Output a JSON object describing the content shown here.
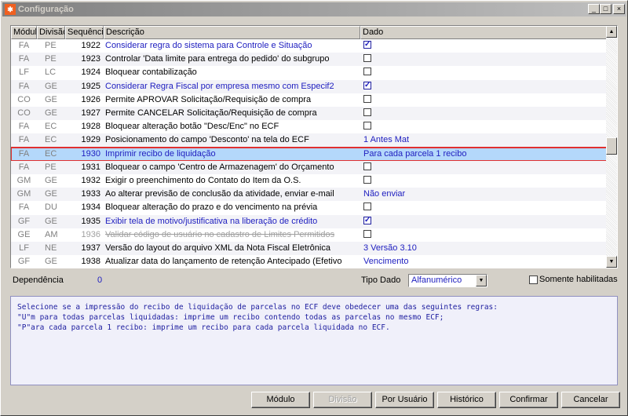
{
  "window": {
    "title": "Configuração",
    "min": "_",
    "max": "□",
    "close": "×"
  },
  "columns": [
    "Módulo",
    "Divisão",
    "Sequência",
    "Descrição",
    "Dado"
  ],
  "rows": [
    {
      "modulo": "FA",
      "divisao": "PE",
      "seq": "1922",
      "desc": "Considerar regra do sistema para Controle e Situação",
      "dado": "",
      "checkbox": true,
      "checked": true,
      "style": "blue"
    },
    {
      "modulo": "FA",
      "divisao": "PE",
      "seq": "1923",
      "desc": "Controlar 'Data limite para entrega do pedido' do subgrupo",
      "dado": "",
      "checkbox": true,
      "checked": false,
      "style": ""
    },
    {
      "modulo": "LF",
      "divisao": "LC",
      "seq": "1924",
      "desc": "Bloquear contabilização",
      "dado": "",
      "checkbox": true,
      "checked": false,
      "style": ""
    },
    {
      "modulo": "FA",
      "divisao": "GE",
      "seq": "1925",
      "desc": "Considerar Regra Fiscal por empresa mesmo com Especif2",
      "dado": "",
      "checkbox": true,
      "checked": true,
      "style": "blue"
    },
    {
      "modulo": "CO",
      "divisao": "GE",
      "seq": "1926",
      "desc": "Permite APROVAR Solicitação/Requisição de compra",
      "dado": "",
      "checkbox": true,
      "checked": false,
      "style": ""
    },
    {
      "modulo": "CO",
      "divisao": "GE",
      "seq": "1927",
      "desc": "Permite CANCELAR Solicitação/Requisição de compra",
      "dado": "",
      "checkbox": true,
      "checked": false,
      "style": ""
    },
    {
      "modulo": "FA",
      "divisao": "EC",
      "seq": "1928",
      "desc": "Bloquear alteração botão \"Desc/Enc\" no ECF",
      "dado": "",
      "checkbox": true,
      "checked": false,
      "style": ""
    },
    {
      "modulo": "FA",
      "divisao": "EC",
      "seq": "1929",
      "desc": "Posicionamento do campo 'Desconto' na tela do ECF",
      "dado": "1 Antes Mat",
      "checkbox": false,
      "checked": false,
      "style": ""
    },
    {
      "modulo": "FA",
      "divisao": "EC",
      "seq": "1930",
      "desc": "Imprimir recibo de liquidação",
      "dado": "Para cada parcela 1 recibo",
      "checkbox": false,
      "checked": false,
      "style": "sel"
    },
    {
      "modulo": "FA",
      "divisao": "PE",
      "seq": "1931",
      "desc": "Bloquear o campo 'Centro de Armazenagem' do Orçamento",
      "dado": "",
      "checkbox": true,
      "checked": false,
      "style": ""
    },
    {
      "modulo": "GM",
      "divisao": "GE",
      "seq": "1932",
      "desc": "Exigir o preenchimento do Contato do Item da O.S.",
      "dado": "",
      "checkbox": true,
      "checked": false,
      "style": ""
    },
    {
      "modulo": "GM",
      "divisao": "GE",
      "seq": "1933",
      "desc": "Ao alterar previsão de conclusão da atividade, enviar e-mail",
      "dado": "Não enviar",
      "checkbox": false,
      "checked": false,
      "style": ""
    },
    {
      "modulo": "FA",
      "divisao": "DU",
      "seq": "1934",
      "desc": "Bloquear alteração do prazo e do vencimento na prévia",
      "dado": "",
      "checkbox": true,
      "checked": false,
      "style": ""
    },
    {
      "modulo": "GF",
      "divisao": "GE",
      "seq": "1935",
      "desc": "Exibir tela de motivo/justificativa na liberação de crédito",
      "dado": "",
      "checkbox": true,
      "checked": true,
      "style": "blue"
    },
    {
      "modulo": "GE",
      "divisao": "AM",
      "seq": "1936",
      "desc": "Validar código de usuário no cadastro de Limites Permitidos",
      "dado": "",
      "checkbox": true,
      "checked": false,
      "style": "strike"
    },
    {
      "modulo": "LF",
      "divisao": "NE",
      "seq": "1937",
      "desc": "Versão do layout do arquivo XML da Nota Fiscal Eletrônica",
      "dado": "3 Versão 3.10",
      "checkbox": false,
      "checked": false,
      "style": ""
    },
    {
      "modulo": "GF",
      "divisao": "GE",
      "seq": "1938",
      "desc": "Atualizar data do lançamento de retenção Antecipado (Efetivo",
      "dado": "Vencimento",
      "checkbox": false,
      "checked": false,
      "style": ""
    }
  ],
  "footer": {
    "dependencia_label": "Dependência",
    "dependencia_value": "0",
    "tipo_dado_label": "Tipo Dado",
    "tipo_dado_value": "Alfanumérico",
    "somente_label": "Somente habilitadas"
  },
  "memo": [
    "Selecione se a impressão do recibo de liquidação de parcelas no ECF deve obedecer uma das seguintes regras:",
    "\"U\"m para todas parcelas liquidadas: imprime um recibo contendo todas as parcelas no mesmo ECF;",
    "\"P\"ara cada parcela 1 recibo: imprime um recibo para cada parcela liquidada no ECF."
  ],
  "buttons": {
    "modulo": "Módulo",
    "divisao": "Divisão",
    "por_usuario": "Por Usuário",
    "historico": "Histórico",
    "confirmar": "Confirmar",
    "cancelar": "Cancelar"
  }
}
